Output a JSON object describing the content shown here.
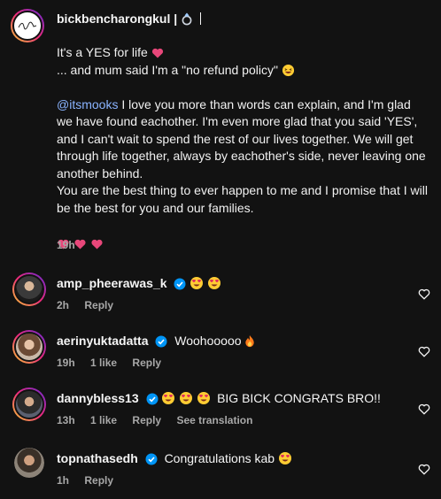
{
  "post": {
    "username": "bickbencharongkul",
    "username_suffix": "|",
    "caption_lines": [
      "It's a YES for life",
      "... and mum said I'm a \"no refund policy\""
    ],
    "mention": "@itsmooks",
    "paragraph1": " I love you more than words can explain, and I'm glad we have found eachother. I'm even more glad that you said 'YES', and I can't wait to spend the rest of our lives together. We will get through life together, always by eachother's side, never leaving one another behind.",
    "paragraph2": "You are the best thing to ever happen to me and I promise that I will be the best for you and our families.",
    "time": "19h"
  },
  "comments": [
    {
      "username": "amp_pheerawas_k",
      "verified": true,
      "text": "",
      "time": "2h",
      "likes": "",
      "reply": "Reply",
      "translate": ""
    },
    {
      "username": "aerinyuktadatta",
      "verified": true,
      "text": "Woohooooo",
      "time": "19h",
      "likes": "1 like",
      "reply": "Reply",
      "translate": ""
    },
    {
      "username": "dannybless13",
      "verified": true,
      "text": "BIG BICK CONGRATS BRO!!",
      "time": "13h",
      "likes": "1 like",
      "reply": "Reply",
      "translate": "See translation"
    },
    {
      "username": "topnathasedh",
      "verified": true,
      "text": "Congratulations kab",
      "time": "1h",
      "likes": "",
      "reply": "Reply",
      "translate": ""
    }
  ],
  "colors": {
    "background": "#121212",
    "mention": "#8ab4ff",
    "verified": "#0095f6",
    "meta": "#a8a8a8"
  },
  "icons": [
    "ring-icon",
    "purple-heart-icon",
    "grinning-squint-emoji",
    "heart-eyes-emoji",
    "fire-emoji",
    "verified-badge-icon",
    "like-heart-icon"
  ]
}
